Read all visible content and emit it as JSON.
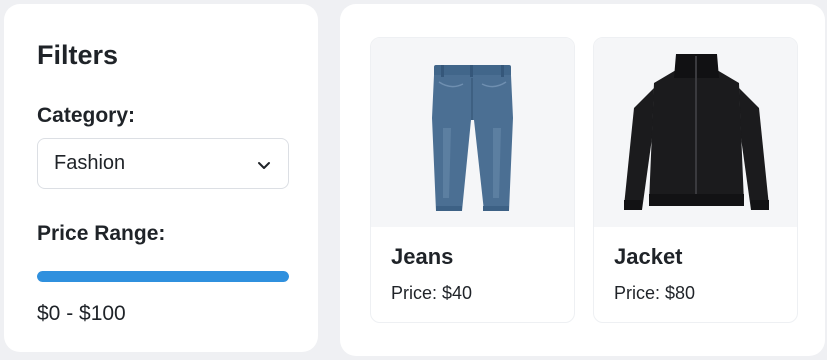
{
  "filters": {
    "title": "Filters",
    "category_label": "Category:",
    "category_value": "Fashion",
    "price_label": "Price Range:",
    "price_range_text": "$0 - $100",
    "price_range_fill_fraction": 1.0
  },
  "products": [
    {
      "name": "Jeans",
      "price": "Price: $40",
      "icon": "jeans-image"
    },
    {
      "name": "Jacket",
      "price": "Price: $80",
      "icon": "jacket-image"
    }
  ],
  "colors": {
    "accent": "#2f90de",
    "jeans": "#4b6f93",
    "jacket": "#1b1b1d"
  }
}
